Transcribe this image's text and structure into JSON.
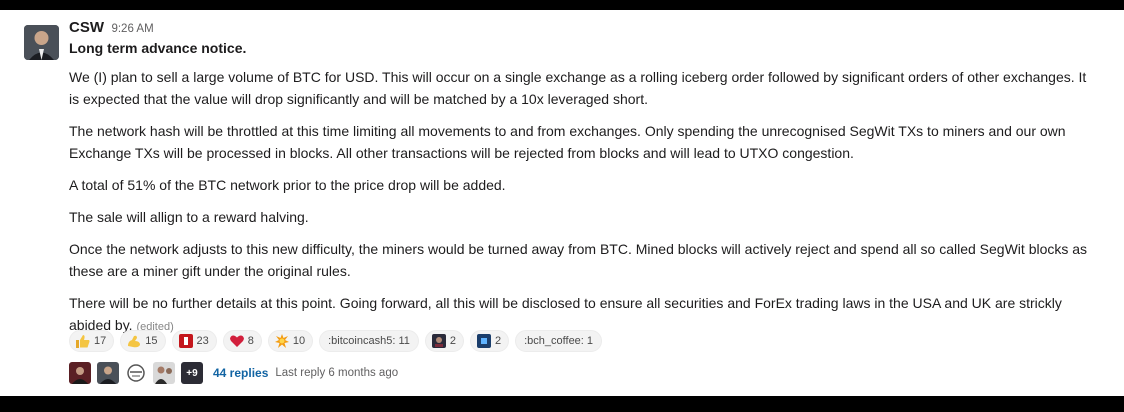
{
  "message": {
    "author": "CSW",
    "time": "9:26 AM",
    "title": "Long term advance notice.",
    "paragraphs": [
      "We (I) plan to sell a large volume of BTC for USD. This will occur on a single exchange as a rolling iceberg order followed by significant orders of other exchanges. It is expected that the value will drop significantly and will be matched by a 10x leveraged short.",
      "The network hash will be throttled at this time limiting all movements to and from exchanges. Only spending the unrecognised SegWit TXs to miners and our own Exchange TXs will be processed in blocks. All other transactions will be rejected from blocks and will lead to UTXO congestion.",
      "A total of 51% of the BTC network prior to the price drop will be added.",
      "The sale will allign to a reward halving.",
      "Once the network adjusts to this new difficulty, the miners would be turned away from BTC. Mined blocks will actively reject and spend all so called SegWit blocks as these are a miner gift under the original rules."
    ],
    "last_paragraph": "There will be no further details at this point. Going forward, all this will be disclosed to ensure all securities and ForEx trading laws in the USA and UK are strickly abided by.",
    "edited": "(edited)"
  },
  "reactions": [
    {
      "icon": "thumbs-up-icon",
      "count": "17"
    },
    {
      "icon": "flexed-arm-icon",
      "count": "15"
    },
    {
      "icon": "red-square-icon",
      "count": "23"
    },
    {
      "icon": "heart-icon",
      "count": "8"
    },
    {
      "icon": "explosion-icon",
      "count": "10"
    },
    {
      "text": ":bitcoincash5: 11"
    },
    {
      "icon": "custom-dark-icon",
      "count": "2"
    },
    {
      "icon": "custom-blue-icon",
      "count": "2"
    },
    {
      "text": ":bch_coffee: 1"
    }
  ],
  "thread": {
    "more": "+9",
    "replies": "44 replies",
    "last_reply": "Last reply 6 months ago"
  },
  "colors": {
    "link": "#1264a3",
    "background": "#ffffff",
    "frame": "#000000"
  }
}
